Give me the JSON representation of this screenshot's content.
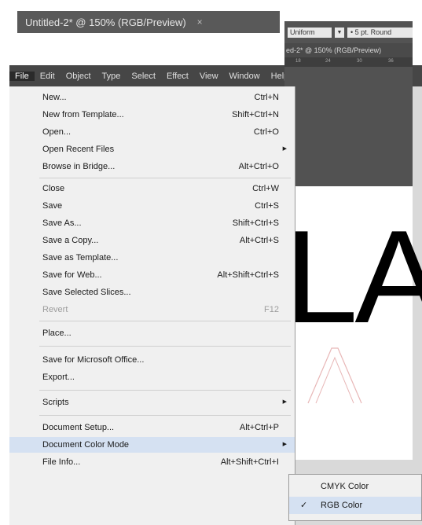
{
  "tab": {
    "title": "Untitled-2* @ 150% (RGB/Preview)",
    "close": "×"
  },
  "menubar": {
    "items": [
      "File",
      "Edit",
      "Object",
      "Type",
      "Select",
      "Effect",
      "View",
      "Window",
      "Help"
    ]
  },
  "control_bar": {
    "stroke_profile": "Uniform",
    "brush": "5 pt. Round"
  },
  "doc_tab": {
    "title": "ed-2* @ 150% (RGB/Preview)"
  },
  "ruler": {
    "ticks": [
      "18",
      "24",
      "30",
      "36"
    ]
  },
  "canvas": {
    "letters": "LA"
  },
  "file_menu": {
    "items": [
      {
        "label": "New...",
        "shortcut": "Ctrl+N"
      },
      {
        "label": "New from Template...",
        "shortcut": "Shift+Ctrl+N"
      },
      {
        "label": "Open...",
        "shortcut": "Ctrl+O"
      },
      {
        "label": "Open Recent Files",
        "shortcut": ""
      },
      {
        "label": "Browse in Bridge...",
        "shortcut": "Alt+Ctrl+O"
      },
      {
        "label": "Close",
        "shortcut": "Ctrl+W"
      },
      {
        "label": "Save",
        "shortcut": "Ctrl+S"
      },
      {
        "label": "Save As...",
        "shortcut": "Shift+Ctrl+S"
      },
      {
        "label": "Save a Copy...",
        "shortcut": "Alt+Ctrl+S"
      },
      {
        "label": "Save as Template...",
        "shortcut": ""
      },
      {
        "label": "Save for Web...",
        "shortcut": "Alt+Shift+Ctrl+S"
      },
      {
        "label": "Save Selected Slices...",
        "shortcut": ""
      },
      {
        "label": "Revert",
        "shortcut": "F12"
      },
      {
        "label": "Place...",
        "shortcut": ""
      },
      {
        "label": "Save for Microsoft Office...",
        "shortcut": ""
      },
      {
        "label": "Export...",
        "shortcut": ""
      },
      {
        "label": "Scripts",
        "shortcut": ""
      },
      {
        "label": "Document Setup...",
        "shortcut": "Alt+Ctrl+P"
      },
      {
        "label": "Document Color Mode",
        "shortcut": ""
      },
      {
        "label": "File Info...",
        "shortcut": "Alt+Shift+Ctrl+I"
      }
    ]
  },
  "submenu": {
    "items": [
      {
        "label": "CMYK Color",
        "check": ""
      },
      {
        "label": "RGB Color",
        "check": "✓"
      }
    ]
  }
}
